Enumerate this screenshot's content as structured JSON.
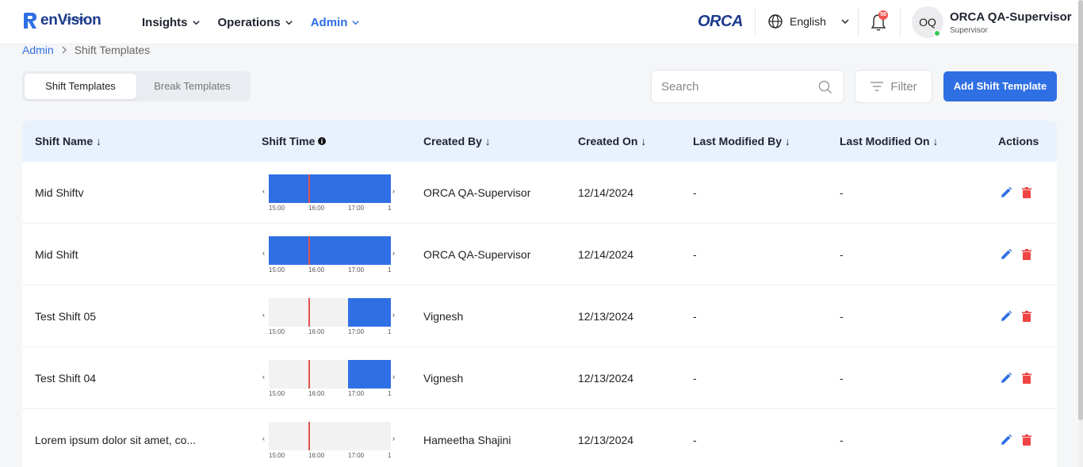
{
  "brand": {
    "name": "enVision",
    "sub": "CONTROL",
    "partner": "ORCA"
  },
  "nav": [
    {
      "label": "Insights"
    },
    {
      "label": "Operations"
    },
    {
      "label": "Admin"
    }
  ],
  "header": {
    "language": "English",
    "notification_count": "58",
    "user_initials": "OQ",
    "user_name": "ORCA QA-Supervisor",
    "user_role": "Supervisor"
  },
  "breadcrumb": {
    "parent": "Admin",
    "current": "Shift Templates"
  },
  "tabs": [
    {
      "label": "Shift Templates"
    },
    {
      "label": "Break Templates"
    }
  ],
  "toolbar": {
    "search_placeholder": "Search",
    "filter_label": "Filter",
    "add_label": "Add Shift Template"
  },
  "table": {
    "columns": {
      "shift_name": "Shift Name ↓",
      "shift_time": "Shift Time",
      "created_by": "Created By ↓",
      "created_on": "Created On ↓",
      "last_modified_by": "Last Modified By ↓",
      "last_modified_on": "Last Modified On ↓",
      "actions": "Actions"
    },
    "timeline_ticks": [
      "15:00",
      "16:00",
      "17:00",
      "1"
    ],
    "rows": [
      {
        "shift_name": "Mid Shiftv",
        "created_by": "ORCA QA-Supervisor",
        "created_on": "12/14/2024",
        "last_modified_by": "-",
        "last_modified_on": "-",
        "shift_fill": [
          0,
          1
        ]
      },
      {
        "shift_name": "Mid Shift",
        "created_by": "ORCA QA-Supervisor",
        "created_on": "12/14/2024",
        "last_modified_by": "-",
        "last_modified_on": "-",
        "shift_fill": [
          0,
          1
        ]
      },
      {
        "shift_name": "Test Shift 05",
        "created_by": "Vignesh",
        "created_on": "12/13/2024",
        "last_modified_by": "-",
        "last_modified_on": "-",
        "shift_fill": [
          0.65,
          1
        ]
      },
      {
        "shift_name": "Test Shift 04",
        "created_by": "Vignesh",
        "created_on": "12/13/2024",
        "last_modified_by": "-",
        "last_modified_on": "-",
        "shift_fill": [
          0.65,
          1
        ]
      },
      {
        "shift_name": "Lorem ipsum dolor sit amet, co...",
        "created_by": "Hameetha Shajini",
        "created_on": "12/13/2024",
        "last_modified_by": "-",
        "last_modified_on": "-",
        "shift_fill": [
          0,
          0
        ]
      }
    ]
  },
  "colors": {
    "accent": "#2f6fe4",
    "now_marker": "#e0524c",
    "danger": "#ef4444",
    "header_bg": "#e9f1fc"
  }
}
